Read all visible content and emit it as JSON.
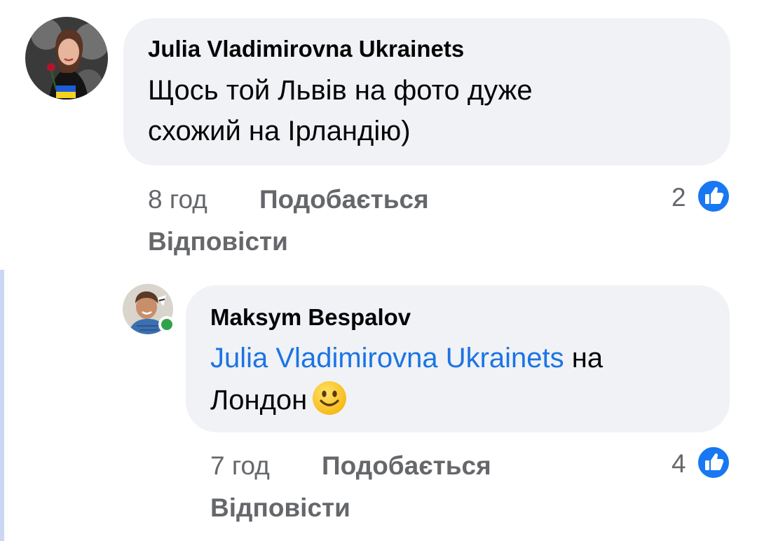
{
  "comments": [
    {
      "author": "Julia Vladimirovna Ukrainets",
      "text_line1": "Щось той Львів на фото дуже",
      "text_line2": "схожий на Ірландію)",
      "time": "8 год",
      "like_label": "Подобається",
      "reply_label": "Відповісти",
      "like_count": "2"
    },
    {
      "author": "Maksym Bespalov",
      "mention": "Julia Vladimirovna Ukrainets",
      "text_after_mention": "на",
      "text_line2": "Лондон",
      "emoji": "slightly-smiling-face",
      "time": "7 год",
      "like_label": "Подобається",
      "reply_label": "Відповісти",
      "like_count": "4"
    }
  ],
  "colors": {
    "bubble": "#f0f2f5",
    "mention": "#1b74e4",
    "meta": "#65676b",
    "like_icon": "#1877f2",
    "online": "#31a24c"
  }
}
